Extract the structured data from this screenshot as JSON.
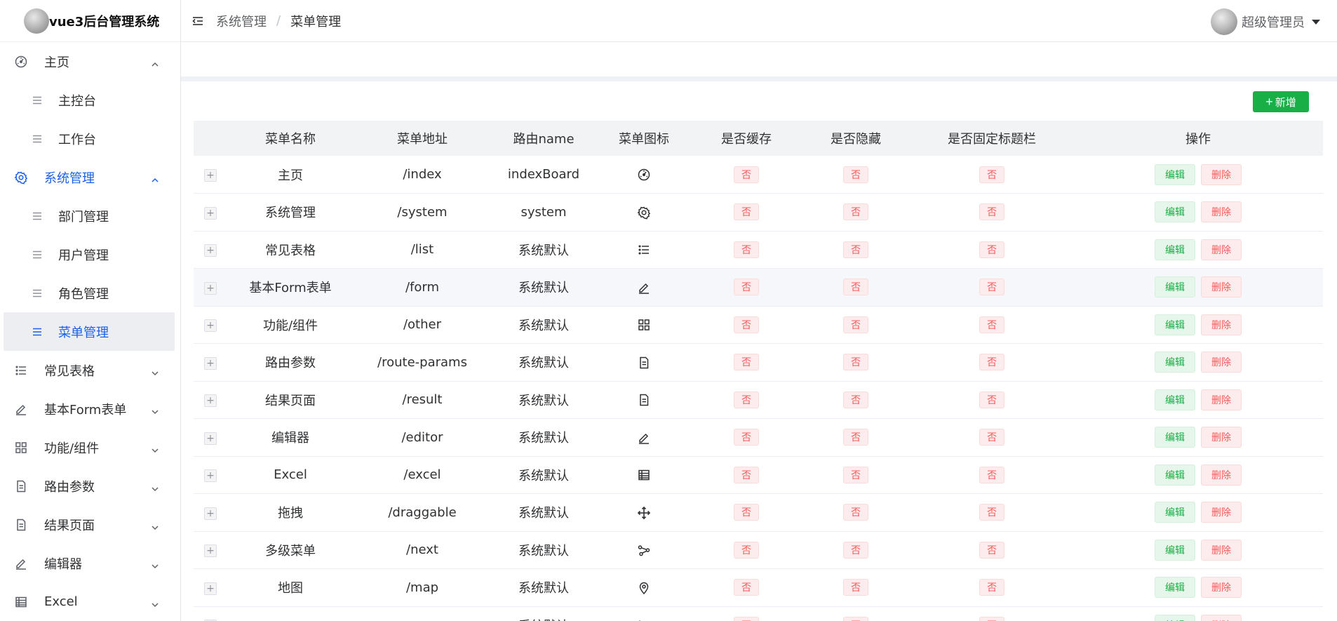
{
  "app": {
    "title": "vue3后台管理系统"
  },
  "sidebar": {
    "items": [
      {
        "label": "主页",
        "icon": "dashboard-icon",
        "expanded": true,
        "active": false,
        "children": [
          {
            "label": "主控台"
          },
          {
            "label": "工作台"
          }
        ]
      },
      {
        "label": "系统管理",
        "icon": "gear-icon",
        "expanded": true,
        "active": true,
        "children": [
          {
            "label": "部门管理"
          },
          {
            "label": "用户管理"
          },
          {
            "label": "角色管理"
          },
          {
            "label": "菜单管理",
            "selected": true
          }
        ]
      },
      {
        "label": "常见表格",
        "icon": "list-icon",
        "expanded": false
      },
      {
        "label": "基本Form表单",
        "icon": "edit-icon",
        "expanded": false
      },
      {
        "label": "功能/组件",
        "icon": "grid-icon",
        "expanded": false
      },
      {
        "label": "路由参数",
        "icon": "document-icon",
        "expanded": false
      },
      {
        "label": "结果页面",
        "icon": "document-icon",
        "expanded": false
      },
      {
        "label": "编辑器",
        "icon": "edit-icon",
        "expanded": false
      },
      {
        "label": "Excel",
        "icon": "table-icon",
        "expanded": false
      }
    ]
  },
  "header": {
    "breadcrumb": [
      "系统管理",
      "菜单管理"
    ],
    "separator": "/",
    "user_name": "超级管理员"
  },
  "toolbar": {
    "add_label": "新增",
    "add_plus": "+"
  },
  "table": {
    "columns": [
      "",
      "菜单名称",
      "菜单地址",
      "路由name",
      "菜单图标",
      "是否缓存",
      "是否隐藏",
      "是否固定标题栏",
      "操作"
    ],
    "expand_symbol": "+",
    "edit_label": "编辑",
    "delete_label": "删除",
    "rows": [
      {
        "name": "主页",
        "path": "/index",
        "route": "indexBoard",
        "icon": "dashboard-icon",
        "cache": "否",
        "hidden": "否",
        "fixed": "否"
      },
      {
        "name": "系统管理",
        "path": "/system",
        "route": "system",
        "icon": "gear-icon",
        "cache": "否",
        "hidden": "否",
        "fixed": "否"
      },
      {
        "name": "常见表格",
        "path": "/list",
        "route": "系统默认",
        "icon": "list-icon",
        "cache": "否",
        "hidden": "否",
        "fixed": "否"
      },
      {
        "name": "基本Form表单",
        "path": "/form",
        "route": "系统默认",
        "icon": "edit-icon",
        "cache": "否",
        "hidden": "否",
        "fixed": "否"
      },
      {
        "name": "功能/组件",
        "path": "/other",
        "route": "系统默认",
        "icon": "grid-icon",
        "cache": "否",
        "hidden": "否",
        "fixed": "否"
      },
      {
        "name": "路由参数",
        "path": "/route-params",
        "route": "系统默认",
        "icon": "document-icon",
        "cache": "否",
        "hidden": "否",
        "fixed": "否"
      },
      {
        "name": "结果页面",
        "path": "/result",
        "route": "系统默认",
        "icon": "document-icon",
        "cache": "否",
        "hidden": "否",
        "fixed": "否"
      },
      {
        "name": "编辑器",
        "path": "/editor",
        "route": "系统默认",
        "icon": "edit-icon",
        "cache": "否",
        "hidden": "否",
        "fixed": "否"
      },
      {
        "name": "Excel",
        "path": "/excel",
        "route": "系统默认",
        "icon": "table-icon",
        "cache": "否",
        "hidden": "否",
        "fixed": "否"
      },
      {
        "name": "拖拽",
        "path": "/draggable",
        "route": "系统默认",
        "icon": "move-icon",
        "cache": "否",
        "hidden": "否",
        "fixed": "否"
      },
      {
        "name": "多级菜单",
        "path": "/next",
        "route": "系统默认",
        "icon": "share-icon",
        "cache": "否",
        "hidden": "否",
        "fixed": "否"
      },
      {
        "name": "地图",
        "path": "/map",
        "route": "系统默认",
        "icon": "location-icon",
        "cache": "否",
        "hidden": "否",
        "fixed": "否"
      },
      {
        "name": "",
        "path": "",
        "route": "系统默认",
        "icon": "list-icon",
        "cache": "否",
        "hidden": "否",
        "fixed": "否"
      }
    ]
  },
  "colors": {
    "primary": "#1c61e6",
    "success": "#18b046",
    "danger": "#f25c5c"
  }
}
